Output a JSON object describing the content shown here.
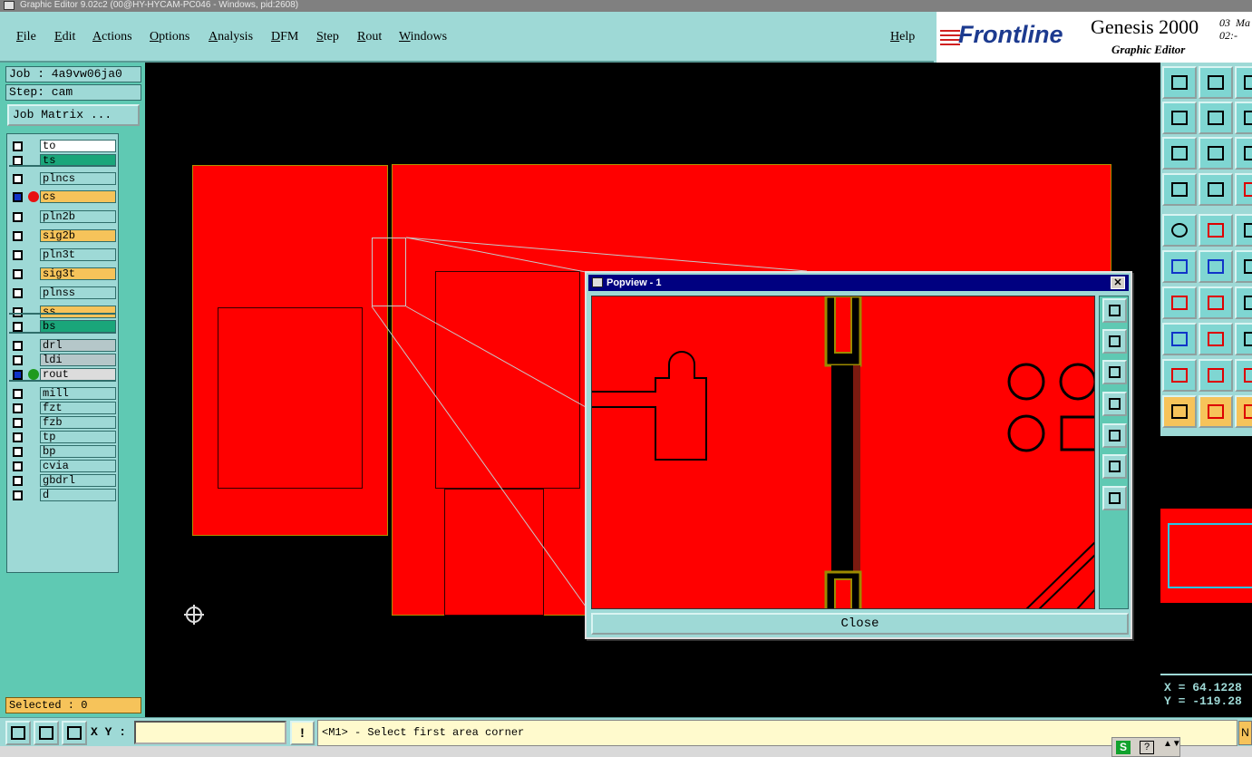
{
  "window": {
    "title": "Graphic Editor 9.02c2 (00@HY-HYCAM-PC046 - Windows, pid:2608)"
  },
  "menu": [
    "File",
    "Edit",
    "Actions",
    "Options",
    "Analysis",
    "DFM",
    "Step",
    "Rout",
    "Windows"
  ],
  "help_label": "Help",
  "brand": {
    "logo": "Frontline",
    "product": "Genesis 2000",
    "subtitle": "Graphic Editor",
    "date": "03  Ma\n02:-"
  },
  "job": {
    "job_label": "Job : 4a9vw06ja0",
    "step_label": "Step: cam",
    "matrix_button": "Job Matrix ..."
  },
  "layers": [
    {
      "name": "to",
      "color": "#ffffff",
      "dot": ""
    },
    {
      "name": "ts",
      "color": "#1aa67a",
      "dot": ""
    },
    {
      "name": "plncs",
      "color": "#9ed9d6",
      "dot": ""
    },
    {
      "name": "cs",
      "color": "#f6c35a",
      "dot": "#e81010"
    },
    {
      "name": "pln2b",
      "color": "#9ed9d6",
      "dot": ""
    },
    {
      "name": "sig2b",
      "color": "#f6c35a",
      "dot": ""
    },
    {
      "name": "pln3t",
      "color": "#9ed9d6",
      "dot": ""
    },
    {
      "name": "sig3t",
      "color": "#f6c35a",
      "dot": ""
    },
    {
      "name": "plnss",
      "color": "#9ed9d6",
      "dot": ""
    },
    {
      "name": "ss",
      "color": "#f6c35a",
      "dot": ""
    },
    {
      "name": "bs",
      "color": "#1aa67a",
      "dot": ""
    },
    {
      "name": "drl",
      "color": "#b5c7c9",
      "dot": ""
    },
    {
      "name": "ldi",
      "color": "#b5c7c9",
      "dot": ""
    },
    {
      "name": "rout",
      "color": "#dcdcdc",
      "dot": "#1e9a1e"
    },
    {
      "name": "mill",
      "color": "#9ed9d6",
      "dot": ""
    },
    {
      "name": "fzt",
      "color": "#9ed9d6",
      "dot": ""
    },
    {
      "name": "fzb",
      "color": "#9ed9d6",
      "dot": ""
    },
    {
      "name": "tp",
      "color": "#9ed9d6",
      "dot": ""
    },
    {
      "name": "bp",
      "color": "#9ed9d6",
      "dot": ""
    },
    {
      "name": "cvia",
      "color": "#9ed9d6",
      "dot": ""
    },
    {
      "name": "gbdrl",
      "color": "#9ed9d6",
      "dot": ""
    },
    {
      "name": "d",
      "color": "#9ed9d6",
      "dot": ""
    }
  ],
  "selected_status": "Selected : 0",
  "popview": {
    "title": "Popview - 1",
    "close_x": "✕",
    "close_button": "Close"
  },
  "coords": {
    "x": "X = 64.1228",
    "y": "Y = -119.28"
  },
  "bottom": {
    "xy_label": "X Y :",
    "xy_value": "",
    "bang": "!",
    "prompt": "<M1> - Select first area corner",
    "prompt_end": "N"
  },
  "mini_tools": {
    "s": "S",
    "q": "?",
    "arrows": "▲▼"
  }
}
